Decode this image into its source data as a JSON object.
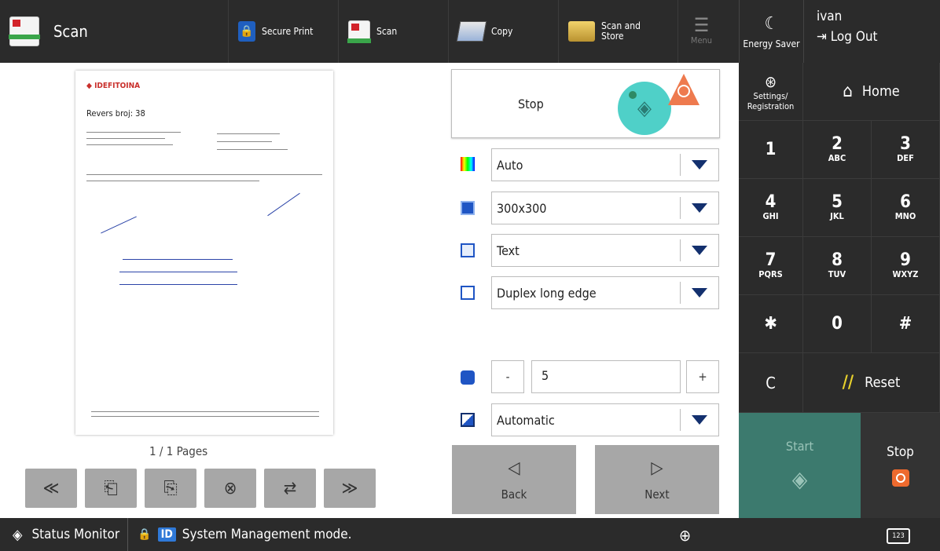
{
  "topbar": {
    "app_title": "Scan",
    "tabs": [
      {
        "label": "Secure Print"
      },
      {
        "label": "Scan"
      },
      {
        "label": "Copy"
      },
      {
        "label": "Scan and Store"
      }
    ],
    "menu_label": "Menu",
    "energy_label": "Energy Saver",
    "user_name": "ivan",
    "logout_label": "Log Out"
  },
  "preview": {
    "page_indicator": "1 / 1 Pages",
    "brand_text": "IDEFITOI​NA",
    "heading_text": "Revers broj: 38",
    "nav_buttons": [
      "«",
      "rotate-left",
      "rotate-right",
      "⊗",
      "page-move",
      "»"
    ]
  },
  "settings": {
    "stop_label": "Stop",
    "color_mode": "Auto",
    "resolution": "300x300",
    "original_type": "Text",
    "duplex": "Duplex long edge",
    "density_value": "5",
    "minus_label": "-",
    "plus_label": "+",
    "size": "Automatic",
    "back_label": "Back",
    "next_label": "Next"
  },
  "keypad": {
    "settings_label": "Settings/ Registration",
    "home_label": "Home",
    "keys": [
      {
        "d": "1",
        "s": ""
      },
      {
        "d": "2",
        "s": "ABC"
      },
      {
        "d": "3",
        "s": "DEF"
      },
      {
        "d": "4",
        "s": "GHI"
      },
      {
        "d": "5",
        "s": "JKL"
      },
      {
        "d": "6",
        "s": "MNO"
      },
      {
        "d": "7",
        "s": "PQRS"
      },
      {
        "d": "8",
        "s": "TUV"
      },
      {
        "d": "9",
        "s": "WXYZ"
      },
      {
        "d": "✱",
        "s": ""
      },
      {
        "d": "0",
        "s": ""
      },
      {
        "d": "#",
        "s": ""
      }
    ],
    "clear_label": "C",
    "reset_label": "Reset",
    "start_label": "Start",
    "stop_label": "Stop"
  },
  "statusbar": {
    "monitor_label": "Status Monitor",
    "id_badge": "ID",
    "mode_text": "System Management mode.",
    "keyboard_label": "123"
  },
  "colors": {
    "start_green": "#3c7a6e",
    "stop_orange": "#ee6a2e",
    "teal": "#4fd0c8",
    "dark": "#2b2b2b"
  }
}
